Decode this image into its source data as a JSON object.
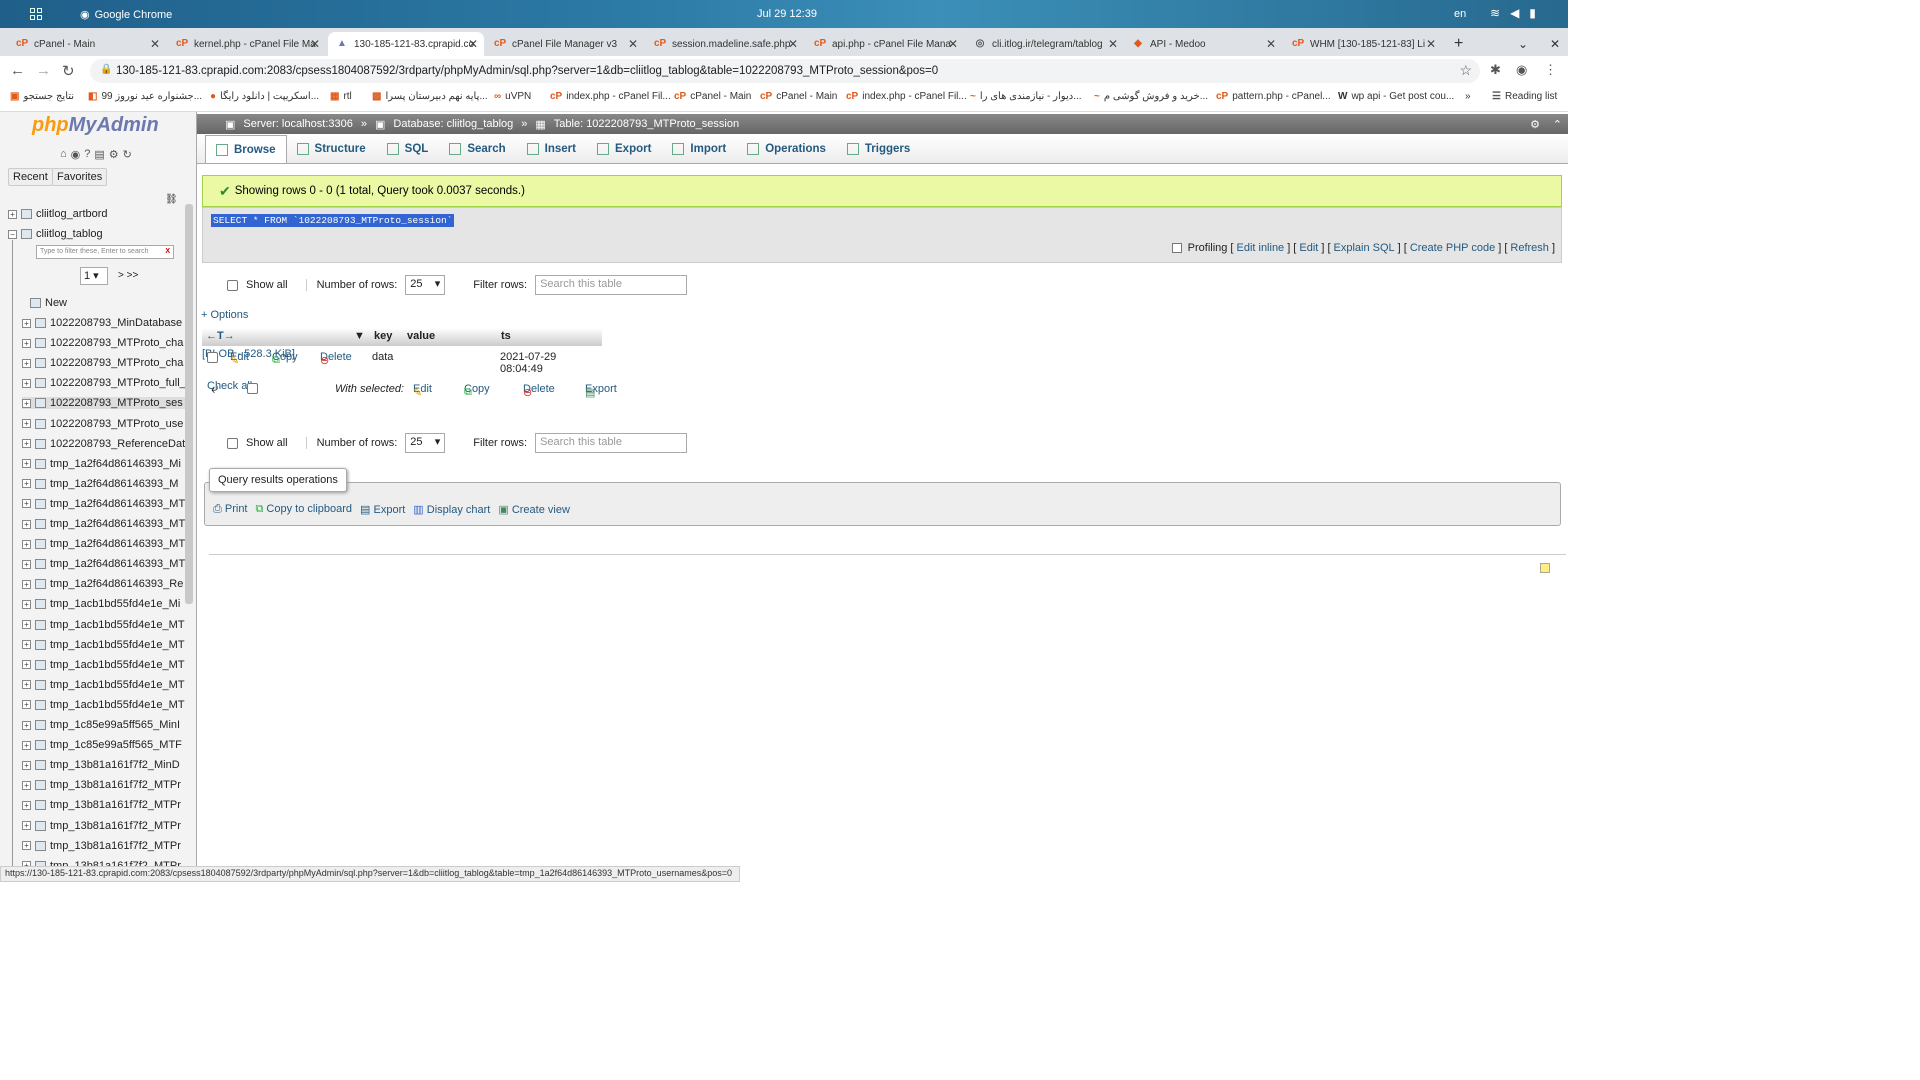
{
  "os": {
    "app": "Google Chrome",
    "clock": "Jul 29  12:39",
    "lang": "en"
  },
  "tabs": [
    {
      "title": "cPanel - Main"
    },
    {
      "title": "kernel.php - cPanel File Ma"
    },
    {
      "title": "130-185-121-83.cprapid.co"
    },
    {
      "title": "cPanel File Manager v3"
    },
    {
      "title": "session.madeline.safe.php"
    },
    {
      "title": "api.php - cPanel File Mana"
    },
    {
      "title": "cli.itlog.ir/telegram/tablog"
    },
    {
      "title": "API - Medoo"
    },
    {
      "title": "WHM [130-185-121-83] Li"
    }
  ],
  "url": "130-185-121-83.cprapid.com:2083/cpsess1804087592/3rdparty/phpMyAdmin/sql.php?server=1&db=cliitlog_tablog&table=1022208793_MTProto_session&pos=0",
  "bookmarks": [
    "نتایج جستجو",
    "جشنواره عید نوروز 99...",
    "اسکریپت | دانلود رایگا...",
    "rtl",
    "پایه نهم دبیرستان پسرا...",
    "uVPN",
    "index.php - cPanel Fil...",
    "cPanel - Main",
    "cPanel - Main",
    "index.php - cPanel Fil...",
    "دیوار - نیازمندی های را...",
    "خرید و فروش گوشی م...",
    "pattern.php - cPanel...",
    "wp api - Get post cou...",
    "Reading list"
  ],
  "sidebar": {
    "logo_php": "php",
    "logo_my": "MyAdmin",
    "recent": "Recent",
    "favorites": "Favorites",
    "databases": [
      "cliitlog_artbord",
      "cliitlog_tablog"
    ],
    "filter_placeholder": "Type to filter these, Enter to search",
    "filter_clear": "X",
    "page": "1",
    "next": "> >>",
    "new": "New",
    "tables": [
      "1022208793_MinDatabase",
      "1022208793_MTProto_cha",
      "1022208793_MTProto_cha",
      "1022208793_MTProto_full_",
      "1022208793_MTProto_ses",
      "1022208793_MTProto_use",
      "1022208793_ReferenceDat",
      "tmp_1a2f64d86146393_Mi",
      "tmp_1a2f64d86146393_M",
      "tmp_1a2f64d86146393_MT",
      "tmp_1a2f64d86146393_MT",
      "tmp_1a2f64d86146393_MT",
      "tmp_1a2f64d86146393_MT",
      "tmp_1a2f64d86146393_Re",
      "tmp_1acb1bd55fd4e1e_Mi",
      "tmp_1acb1bd55fd4e1e_MT",
      "tmp_1acb1bd55fd4e1e_MT",
      "tmp_1acb1bd55fd4e1e_MT",
      "tmp_1acb1bd55fd4e1e_MT",
      "tmp_1acb1bd55fd4e1e_MT",
      "tmp_1c85e99a5ff565_MinI",
      "tmp_1c85e99a5ff565_MTF",
      "tmp_13b81a161f7f2_MinD",
      "tmp_13b81a161f7f2_MTPr",
      "tmp_13b81a161f7f2_MTPr",
      "tmp_13b81a161f7f2_MTPr",
      "tmp_13b81a161f7f2_MTPr",
      "tmp_13b81a161f7f2_MTPr"
    ]
  },
  "breadcrumb": {
    "server": "Server: localhost:3306",
    "database": "Database: cliitlog_tablog",
    "table": "Table: 1022208793_MTProto_session"
  },
  "main_tabs": [
    "Browse",
    "Structure",
    "SQL",
    "Search",
    "Insert",
    "Export",
    "Import",
    "Operations",
    "Triggers"
  ],
  "success": "Showing rows 0 - 0 (1 total, Query took 0.0037 seconds.)",
  "sql": "SELECT * FROM `1022208793_MTProto_session`",
  "sql_links": {
    "profiling": "Profiling",
    "edit_inline": "Edit inline",
    "edit": "Edit",
    "explain": "Explain SQL",
    "php": "Create PHP code",
    "refresh": "Refresh"
  },
  "controls": {
    "show_all": "Show all",
    "num_rows": "Number of rows:",
    "rows_value": "25",
    "filter": "Filter rows:",
    "filter_placeholder": "Search this table"
  },
  "options": "+ Options",
  "columns": [
    "key",
    "value",
    "ts"
  ],
  "row": {
    "edit": "Edit",
    "copy": "Copy",
    "delete": "Delete",
    "key": "data",
    "value": "[BLOB - 528.3 KiB]",
    "ts": "2021-07-29 08:04:49"
  },
  "with_selected": {
    "check_all": "Check all",
    "label": "With selected:",
    "edit": "Edit",
    "copy": "Copy",
    "delete": "Delete",
    "export": "Export"
  },
  "qro": {
    "legend": "Query results operations",
    "print": "Print",
    "clipboard": "Copy to clipboard",
    "export": "Export",
    "chart": "Display chart",
    "view": "Create view"
  },
  "status_url": "https://130-185-121-83.cprapid.com:2083/cpsess1804087592/3rdparty/phpMyAdmin/sql.php?server=1&db=cliitlog_tablog&table=tmp_1a2f64d86146393_MTProto_usernames&pos=0"
}
